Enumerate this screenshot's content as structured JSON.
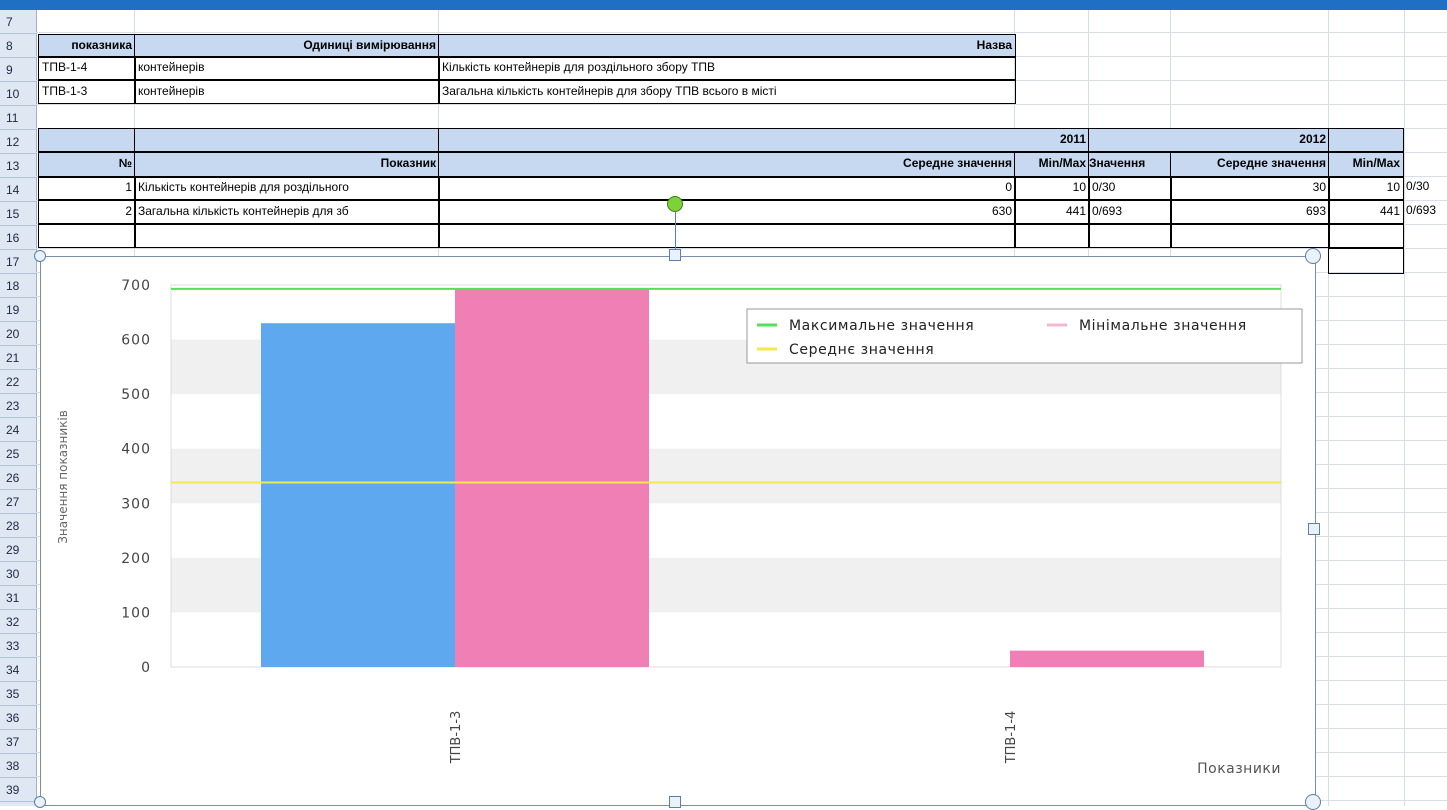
{
  "row_numbers": [
    "7",
    "8",
    "9",
    "10",
    "11",
    "12",
    "13",
    "14",
    "15",
    "16",
    "17",
    "18",
    "19",
    "20",
    "21",
    "22",
    "23",
    "24",
    "25",
    "26",
    "27",
    "28",
    "29",
    "30",
    "31",
    "32",
    "33",
    "34",
    "35",
    "36",
    "37",
    "38",
    "39"
  ],
  "table1": {
    "headers": [
      "показника",
      "Одиниці вимірювання",
      "Назва"
    ],
    "rows": [
      [
        "ТПВ-1-4",
        "контейнерів",
        "Кількість контейнерів для роздільного збору ТПВ"
      ],
      [
        "ТПВ-1-3",
        "контейнерів",
        "Загальна кількість контейнерів для збору ТПВ всього в місті"
      ]
    ]
  },
  "table2": {
    "year_2011": "2011",
    "year_2012": "2012",
    "headers": [
      "№",
      "Показник",
      "Середне значення",
      "Min/Max",
      "Значення",
      "Середне значення",
      "Min/Max"
    ],
    "rows": [
      {
        "n": "1",
        "name": "Кількість контейнерів для роздільного",
        "avg2011": "0",
        "mm2011": "10",
        "val": "0/30",
        "avg2012": "30",
        "mm2012": "10",
        "extra": "0/30"
      },
      {
        "n": "2",
        "name": "Загальна кількість контейнерів для зб",
        "avg2011": "630",
        "mm2011": "441",
        "val": "0/693",
        "avg2012": "693",
        "mm2012": "441",
        "extra": "0/693"
      }
    ]
  },
  "chart_data": {
    "type": "bar",
    "categories": [
      "ТПВ-1-3",
      "ТПВ-1-4"
    ],
    "series": [
      {
        "values": [
          630,
          0
        ],
        "color": "#5ea8f0"
      },
      {
        "values": [
          693,
          30
        ],
        "color": "#f07fb6"
      }
    ],
    "reference_lines": [
      {
        "name": "Максимальне значення",
        "value": 693,
        "color": "#55e05a"
      },
      {
        "name": "Мінімальне значення",
        "value": null,
        "color": "#f9b4cf"
      },
      {
        "name": "Середнє значення",
        "value": 338,
        "color": "#f2ea4a"
      }
    ],
    "ylabel": "Значення показників",
    "xlabel": "Показники",
    "ylim": [
      0,
      700
    ],
    "yticks": [
      "0",
      "100",
      "200",
      "300",
      "400",
      "500",
      "600",
      "700"
    ],
    "grid": "alternating bands",
    "legend_position": "top-right"
  }
}
